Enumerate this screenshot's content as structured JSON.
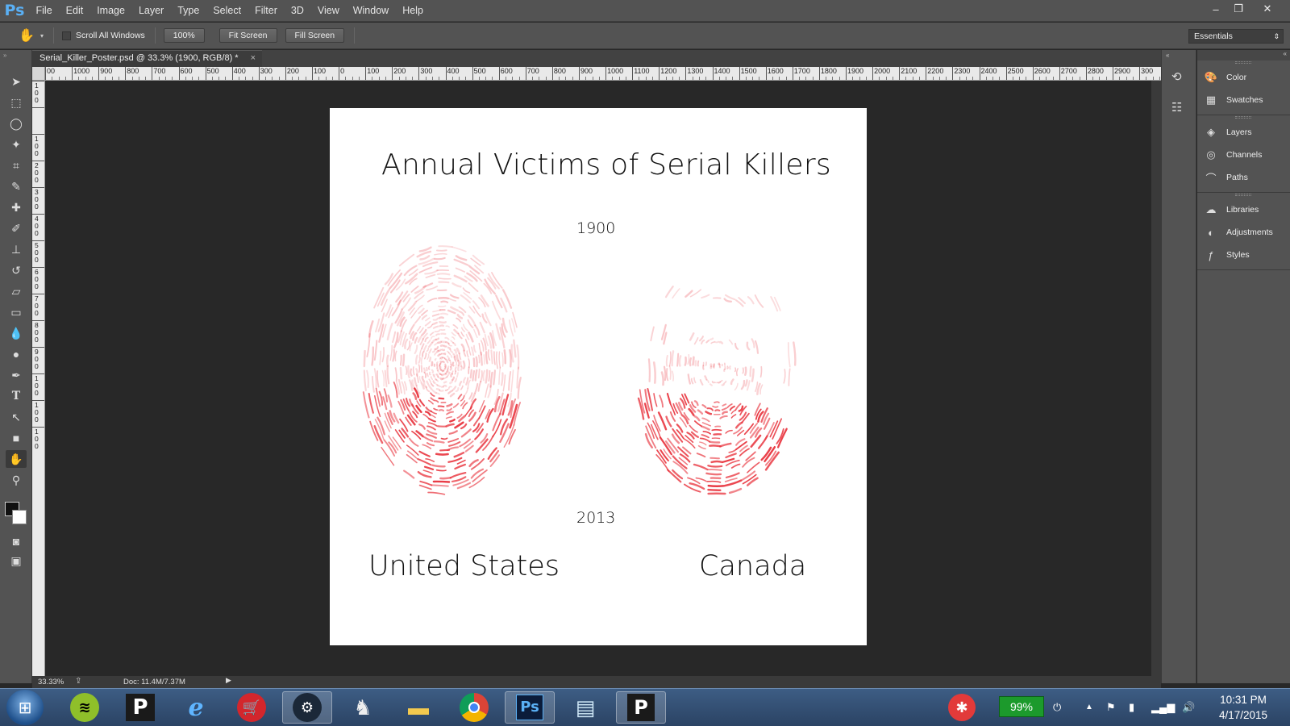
{
  "app": {
    "logo": "Ps"
  },
  "menu": [
    "File",
    "Edit",
    "Image",
    "Layer",
    "Type",
    "Select",
    "Filter",
    "3D",
    "View",
    "Window",
    "Help"
  ],
  "window_controls": {
    "minimize": "‒",
    "restore": "❐",
    "close": "✕"
  },
  "options_bar": {
    "scroll_all_windows": "Scroll All Windows",
    "zoom_button": "100%",
    "fit_screen": "Fit Screen",
    "fill_screen": "Fill Screen",
    "workspace": "Essentials"
  },
  "document_tab": {
    "title": "Serial_Killer_Poster.psd @ 33.3% (1900, RGB/8) *",
    "close": "×"
  },
  "ruler_top_labels": [
    "00",
    "1000",
    "900",
    "800",
    "700",
    "600",
    "500",
    "400",
    "300",
    "200",
    "100",
    "0",
    "100",
    "200",
    "300",
    "400",
    "500",
    "600",
    "700",
    "800",
    "900",
    "1000",
    "1100",
    "1200",
    "1300",
    "1400",
    "1500",
    "1600",
    "1700",
    "1800",
    "1900",
    "2000",
    "2100",
    "2200",
    "2300",
    "2400",
    "2500",
    "2600",
    "2700",
    "2800",
    "2900",
    "300"
  ],
  "ruler_left_labels": [
    "1\n0\n0",
    "",
    "1\n0\n0",
    "2\n0\n0",
    "3\n0\n0",
    "4\n0\n0",
    "5\n0\n0",
    "6\n0\n0",
    "7\n0\n0",
    "8\n0\n0",
    "9\n0\n0",
    "1\n0\n0",
    "1\n0\n0",
    "1\n0\n0"
  ],
  "poster": {
    "title": "Annual Victims of Serial Killers",
    "year_top": "1900",
    "year_bottom": "2013",
    "country_left": "United States",
    "country_right": "Canada",
    "accent": "#e8303a"
  },
  "panels": {
    "group1": [
      "Color",
      "Swatches"
    ],
    "group2": [
      "Layers",
      "Channels",
      "Paths"
    ],
    "group3": [
      "Libraries",
      "Adjustments",
      "Styles"
    ]
  },
  "status": {
    "zoom": "33.33%",
    "doc": "Doc: 11.4M/7.37M"
  },
  "taskbar": {
    "apps": [
      "spotify",
      "pandora",
      "internet-explorer",
      "shopping",
      "steam",
      "hunter",
      "file-explorer",
      "chrome",
      "photoshop",
      "notepad",
      "pandora-2"
    ],
    "pandora_label": "P",
    "ps_label": "Ps",
    "battery": "99%",
    "time": "10:31 PM",
    "date": "4/17/2015"
  }
}
